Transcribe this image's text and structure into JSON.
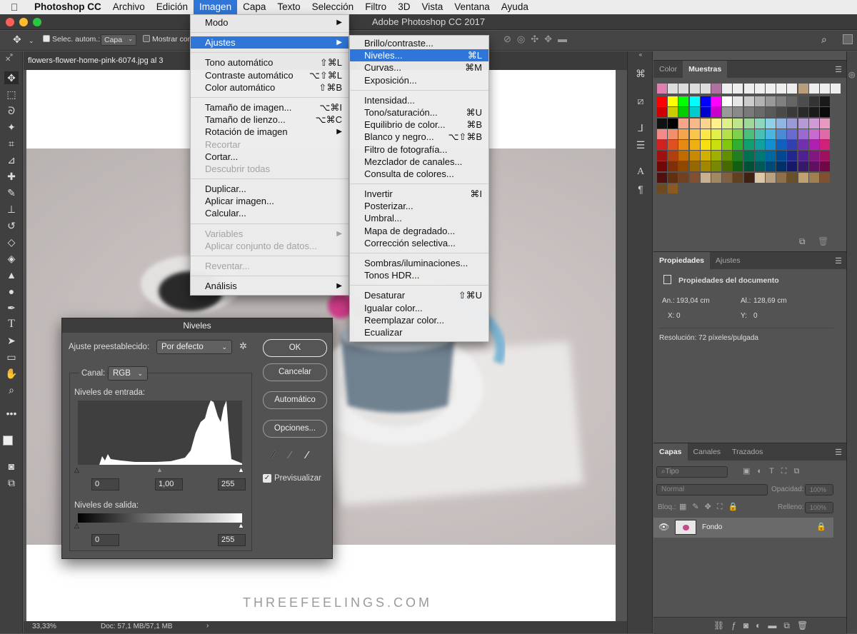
{
  "menubar": {
    "items": [
      "Photoshop CC",
      "Archivo",
      "Edición",
      "Imagen",
      "Capa",
      "Texto",
      "Selección",
      "Filtro",
      "3D",
      "Vista",
      "Ventana",
      "Ayuda"
    ]
  },
  "window": {
    "title": "Adobe Photoshop CC 2017"
  },
  "options": {
    "auto_select_label": "Selec. autom.:",
    "auto_select_value": "Capa",
    "show_transform_label": "Mostrar cont"
  },
  "document": {
    "tab_label": "flowers-flower-home-pink-6074.jpg al 3",
    "zoom": "33,33%",
    "doc_size": "Doc: 57,1 MB/57,1 MB",
    "watermark": "THREEFEELINGS.COM"
  },
  "imagen_menu": {
    "items": [
      {
        "label": "Modo",
        "arrow": true
      },
      {
        "sep": true
      },
      {
        "label": "Ajustes",
        "arrow": true,
        "selected": true
      },
      {
        "sep": true
      },
      {
        "label": "Tono automático",
        "sc": "⇧⌘L"
      },
      {
        "label": "Contraste automático",
        "sc": "⌥⇧⌘L"
      },
      {
        "label": "Color automático",
        "sc": "⇧⌘B"
      },
      {
        "sep": true
      },
      {
        "label": "Tamaño de imagen...",
        "sc": "⌥⌘I"
      },
      {
        "label": "Tamaño de lienzo...",
        "sc": "⌥⌘C"
      },
      {
        "label": "Rotación de imagen",
        "arrow": true
      },
      {
        "label": "Recortar",
        "disabled": true
      },
      {
        "label": "Cortar..."
      },
      {
        "label": "Descubrir todas",
        "disabled": true
      },
      {
        "sep": true
      },
      {
        "label": "Duplicar..."
      },
      {
        "label": "Aplicar imagen..."
      },
      {
        "label": "Calcular..."
      },
      {
        "sep": true
      },
      {
        "label": "Variables",
        "arrow": true,
        "disabled": true
      },
      {
        "label": "Aplicar conjunto de datos...",
        "disabled": true
      },
      {
        "sep": true
      },
      {
        "label": "Reventar...",
        "disabled": true
      },
      {
        "sep": true
      },
      {
        "label": "Análisis",
        "arrow": true
      }
    ]
  },
  "ajustes_menu": {
    "items": [
      {
        "label": "Brillo/contraste..."
      },
      {
        "label": "Niveles...",
        "sc": "⌘L",
        "selected": true
      },
      {
        "label": "Curvas...",
        "sc": "⌘M"
      },
      {
        "label": "Exposición..."
      },
      {
        "sep": true
      },
      {
        "label": "Intensidad..."
      },
      {
        "label": "Tono/saturación...",
        "sc": "⌘U"
      },
      {
        "label": "Equilibrio de color...",
        "sc": "⌘B"
      },
      {
        "label": "Blanco y negro...",
        "sc": "⌥⇧⌘B"
      },
      {
        "label": "Filtro de fotografía..."
      },
      {
        "label": "Mezclador de canales..."
      },
      {
        "label": "Consulta de colores..."
      },
      {
        "sep": true
      },
      {
        "label": "Invertir",
        "sc": "⌘I"
      },
      {
        "label": "Posterizar..."
      },
      {
        "label": "Umbral..."
      },
      {
        "label": "Mapa de degradado..."
      },
      {
        "label": "Corrección selectiva..."
      },
      {
        "sep": true
      },
      {
        "label": "Sombras/iluminaciones..."
      },
      {
        "label": "Tonos HDR..."
      },
      {
        "sep": true
      },
      {
        "label": "Desaturar",
        "sc": "⇧⌘U"
      },
      {
        "label": "Igualar color..."
      },
      {
        "label": "Reemplazar color..."
      },
      {
        "label": "Ecualizar"
      }
    ]
  },
  "levels": {
    "title": "Niveles",
    "preset_label": "Ajuste preestablecido:",
    "preset_value": "Por defecto",
    "channel_label": "Canal:",
    "channel_value": "RGB",
    "input_label": "Niveles de entrada:",
    "input_values": [
      "0",
      "1,00",
      "255"
    ],
    "output_label": "Niveles de salida:",
    "output_values": [
      "0",
      "255"
    ],
    "buttons": {
      "ok": "OK",
      "cancel": "Cancelar",
      "auto": "Automático",
      "options": "Opciones..."
    },
    "preview_label": "Previsualizar",
    "preview_checked": true
  },
  "color_panel": {
    "tabs": [
      "Color",
      "Muestras"
    ],
    "active_tab": "Muestras"
  },
  "properties_panel": {
    "tabs": [
      "Propiedades",
      "Ajustes"
    ],
    "heading": "Propiedades del documento",
    "width_label": "An.:",
    "width_value": "193,04 cm",
    "height_label": "Al.:",
    "height_value": "128,69 cm",
    "x_label": "X:",
    "x_value": "0",
    "y_label": "Y:",
    "y_value": "0",
    "resolution": "Resolución: 72 píxeles/pulgada"
  },
  "layers_panel": {
    "tabs": [
      "Capas",
      "Canales",
      "Trazados"
    ],
    "filter_placeholder": "Tipo",
    "blend_mode": "Normal",
    "opacity_label": "Opacidad:",
    "opacity_value": "100%",
    "lock_label": "Bloq.:",
    "fill_label": "Relleno:",
    "fill_value": "100%",
    "layer_name": "Fondo"
  },
  "colors": {
    "menu_highlight": "#2f76d8",
    "panel_bg": "#535353",
    "menubar_bg": "#ececec"
  }
}
